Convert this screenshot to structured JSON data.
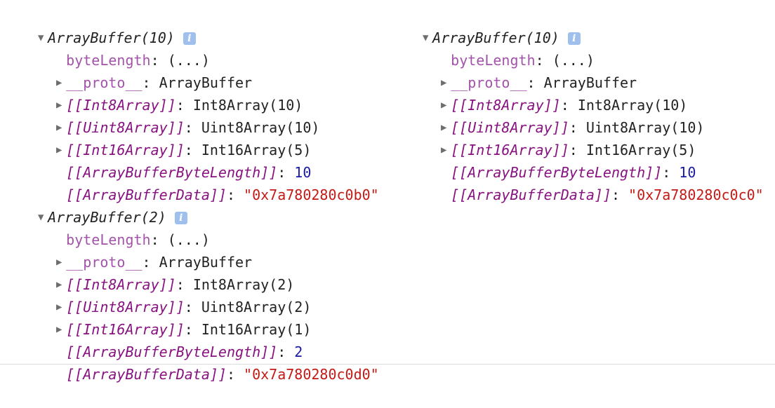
{
  "left": {
    "title": "ArrayBuffer(10)",
    "rows": [
      {
        "key": "byteLength",
        "value": "(...)"
      },
      {
        "key": "__proto__",
        "value": "ArrayBuffer"
      },
      {
        "key": "[[Int8Array]]",
        "value": "Int8Array(10)"
      },
      {
        "key": "[[Uint8Array]]",
        "value": "Uint8Array(10)"
      },
      {
        "key": "[[Int16Array]]",
        "value": "Int16Array(5)"
      },
      {
        "key": "[[ArrayBufferByteLength]]",
        "value": "10"
      },
      {
        "key": "[[ArrayBufferData]]",
        "value": "\"0x7a780280c0b0\""
      }
    ]
  },
  "right": {
    "title": "ArrayBuffer(10)",
    "rows": [
      {
        "key": "byteLength",
        "value": "(...)"
      },
      {
        "key": "__proto__",
        "value": "ArrayBuffer"
      },
      {
        "key": "[[Int8Array]]",
        "value": "Int8Array(10)"
      },
      {
        "key": "[[Uint8Array]]",
        "value": "Uint8Array(10)"
      },
      {
        "key": "[[Int16Array]]",
        "value": "Int16Array(5)"
      },
      {
        "key": "[[ArrayBufferByteLength]]",
        "value": "10"
      },
      {
        "key": "[[ArrayBufferData]]",
        "value": "\"0x7a780280c0c0\""
      }
    ]
  },
  "bottom": {
    "title": "ArrayBuffer(2)",
    "rows": [
      {
        "key": "byteLength",
        "value": "(...)"
      },
      {
        "key": "__proto__",
        "value": "ArrayBuffer"
      },
      {
        "key": "[[Int8Array]]",
        "value": "Int8Array(2)"
      },
      {
        "key": "[[Uint8Array]]",
        "value": "Uint8Array(2)"
      },
      {
        "key": "[[Int16Array]]",
        "value": "Int16Array(1)"
      },
      {
        "key": "[[ArrayBufferByteLength]]",
        "value": "2"
      },
      {
        "key": "[[ArrayBufferData]]",
        "value": "\"0x7a780280c0d0\""
      }
    ]
  },
  "separator": ": ",
  "icons": {
    "expanded": "▼",
    "collapsed": "▶",
    "info": "i"
  }
}
